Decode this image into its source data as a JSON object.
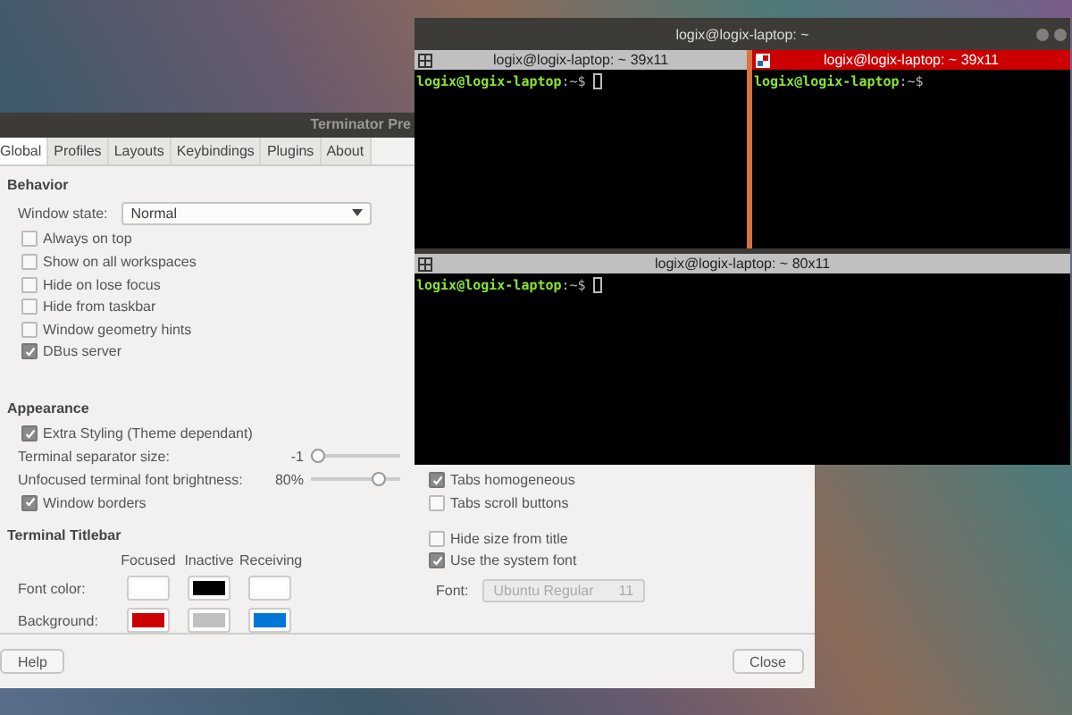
{
  "preferences": {
    "title": "Terminator Pre",
    "tabs": [
      {
        "label": "Global",
        "selected": true
      },
      {
        "label": "Profiles",
        "selected": false
      },
      {
        "label": "Layouts",
        "selected": false
      },
      {
        "label": "Keybindings",
        "selected": false
      },
      {
        "label": "Plugins",
        "selected": false
      },
      {
        "label": "About",
        "selected": false
      }
    ],
    "behavior": {
      "heading": "Behavior",
      "window_state": {
        "label": "Window state:",
        "value": "Normal"
      },
      "options": [
        {
          "label": "Always on top",
          "checked": false
        },
        {
          "label": "Show on all workspaces",
          "checked": false
        },
        {
          "label": "Hide on lose focus",
          "checked": false
        },
        {
          "label": "Hide from taskbar",
          "checked": false
        },
        {
          "label": "Window geometry hints",
          "checked": false
        },
        {
          "label": "DBus server",
          "checked": true
        }
      ]
    },
    "appearance": {
      "heading": "Appearance",
      "extra_styling": {
        "label": "Extra Styling (Theme dependant)",
        "checked": true
      },
      "sliders": [
        {
          "label": "Terminal separator size:",
          "reading": "-1",
          "level": 0
        },
        {
          "label": "Unfocused terminal font brightness:",
          "reading": "80%",
          "level": 0.8
        }
      ],
      "window_borders": {
        "label": "Window borders",
        "checked": true
      }
    },
    "titlebar": {
      "heading": "Terminal Titlebar",
      "columns": [
        "Focused",
        "Inactive",
        "Receiving"
      ],
      "rows": [
        {
          "label": "Font color:",
          "swatches": [
            {
              "color": "#ffffff"
            },
            {
              "color": "#000000"
            },
            {
              "color": "#ffffff"
            }
          ]
        },
        {
          "label": "Background:",
          "swatches": [
            {
              "color": "#cc0000"
            },
            {
              "color": "#c0c0c0"
            },
            {
              "color": "#0076d6"
            }
          ]
        }
      ]
    },
    "tab_options": [
      {
        "label": "Tabs homogeneous",
        "checked": true
      },
      {
        "label": "Tabs scroll buttons",
        "checked": false
      }
    ],
    "title_options": [
      {
        "label": "Hide size from title",
        "checked": false
      },
      {
        "label": "Use the system font",
        "checked": true
      }
    ],
    "font": {
      "label": "Font:",
      "value": "Ubuntu Regular",
      "size": "11",
      "disabled": true
    },
    "help_button": "Help",
    "close_button": "Close"
  },
  "terminal": {
    "title": "logix@logix-laptop: ~",
    "panes": [
      {
        "title": "logix@logix-laptop: ~ 39x11",
        "focused": false,
        "prompt_user": "logix@logix-laptop",
        "prompt_path": ":~$"
      },
      {
        "title": "logix@logix-laptop: ~ 39x11",
        "focused": true,
        "prompt_user": "logix@logix-laptop",
        "prompt_path": ":~$"
      },
      {
        "title": "logix@logix-laptop: ~ 80x11",
        "focused": false,
        "prompt_user": "logix@logix-laptop",
        "prompt_path": ":~$"
      }
    ]
  }
}
